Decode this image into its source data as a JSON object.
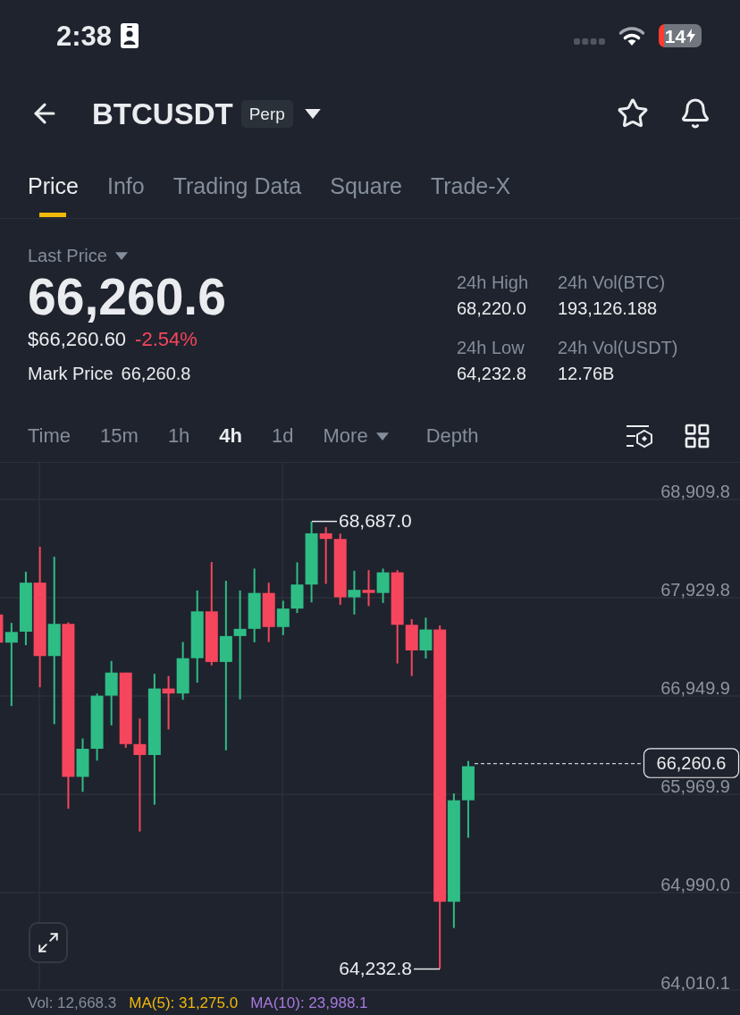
{
  "status_bar": {
    "time": "2:38",
    "battery": "14"
  },
  "header": {
    "symbol": "BTCUSDT",
    "badge": "Perp"
  },
  "tabs": [
    {
      "label": "Price",
      "selected": true
    },
    {
      "label": "Info",
      "selected": false
    },
    {
      "label": "Trading Data",
      "selected": false
    },
    {
      "label": "Square",
      "selected": false
    },
    {
      "label": "Trade-X",
      "selected": false
    }
  ],
  "price": {
    "label": "Last Price",
    "last": "66,260.6",
    "usd": "$66,260.60",
    "change": "-2.54%",
    "falling": true,
    "mark_label": "Mark Price",
    "mark": "66,260.8"
  },
  "stats": [
    {
      "label": "24h High",
      "value": "68,220.0"
    },
    {
      "label": "24h Vol(BTC)",
      "value": "193,126.188"
    },
    {
      "label": "24h Low",
      "value": "64,232.8"
    },
    {
      "label": "24h Vol(USDT)",
      "value": "12.76B"
    }
  ],
  "intervals": [
    {
      "label": "Time",
      "selected": false
    },
    {
      "label": "15m",
      "selected": false
    },
    {
      "label": "1h",
      "selected": false
    },
    {
      "label": "4h",
      "selected": true
    },
    {
      "label": "1d",
      "selected": false
    },
    {
      "label": "More",
      "selected": false,
      "dropdown": true
    },
    {
      "label": "Depth",
      "selected": false
    }
  ],
  "chart": {
    "y_axis": [
      "68,909.8",
      "67,929.8",
      "66,949.9",
      "65,969.9",
      "64,990.0",
      "64,010.1"
    ],
    "high_marker": "68,687.0",
    "low_marker": "64,232.8",
    "current_price": "66,260.6"
  },
  "indicators": [
    {
      "label": "Vol: 12,668.3",
      "color": "#848e9c"
    },
    {
      "label": "MA(5): 31,275.0",
      "color": "#f0b90b"
    },
    {
      "label": "MA(10): 23,988.1",
      "color": "#a879de"
    }
  ]
}
